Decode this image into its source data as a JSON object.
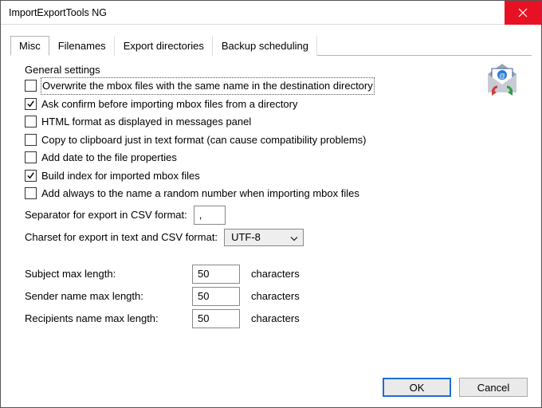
{
  "window": {
    "title": "ImportExportTools NG"
  },
  "tabs": [
    "Misc",
    "Filenames",
    "Export directories",
    "Backup scheduling"
  ],
  "general": {
    "heading": "General settings",
    "opts": {
      "overwrite": "Overwrite the mbox files with the same name in the destination directory",
      "askconfirm": "Ask confirm before importing mbox files from a directory",
      "htmlformat": "HTML format as displayed in messages panel",
      "copyclip": "Copy to clipboard just in text format (can cause compatibility problems)",
      "adddate": "Add date to the file properties",
      "buildindex": "Build index for imported mbox files",
      "addrandom": "Add always to the name a random number when importing mbox files"
    },
    "separator_label": "Separator for export in CSV format:",
    "separator_value": ",",
    "charset_label": "Charset for export in text and CSV format:",
    "charset_value": "UTF-8"
  },
  "lengths": {
    "subject_label": "Subject max length:",
    "subject_value": "50",
    "sender_label": "Sender name max length:",
    "sender_value": "50",
    "recipients_label": "Recipients name max length:",
    "recipients_value": "50",
    "suffix": "characters"
  },
  "buttons": {
    "ok": "OK",
    "cancel": "Cancel"
  }
}
